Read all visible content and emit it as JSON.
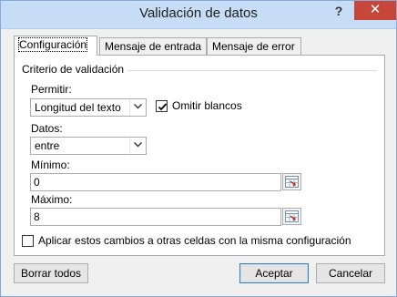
{
  "window": {
    "title": "Validación de datos",
    "help_label": "?",
    "close_label": "✕"
  },
  "tabs": [
    {
      "label": "Configuración",
      "active": true
    },
    {
      "label": "Mensaje de entrada",
      "active": false
    },
    {
      "label": "Mensaje de error",
      "active": false
    }
  ],
  "criteria": {
    "group_title": "Criterio de validación",
    "permitir": {
      "label": "Permitir:",
      "value": "Longitud del texto"
    },
    "omitir_blancos": {
      "label": "Omitir blancos",
      "checked": true
    },
    "datos": {
      "label": "Datos:",
      "value": "entre"
    },
    "minimo": {
      "label": "Mínimo:",
      "value": "0"
    },
    "maximo": {
      "label": "Máximo:",
      "value": "8"
    }
  },
  "apply_all": {
    "label": "Aplicar estos cambios a otras celdas con la misma configuración",
    "checked": false
  },
  "buttons": {
    "clear_all": "Borrar todos",
    "accept": "Aceptar",
    "cancel": "Cancelar"
  },
  "icons": {
    "help": "help-icon",
    "close": "close-icon",
    "dropdown": "chevron-down-icon",
    "checkmark": "checkmark-icon",
    "range_selector": "range-selector-icon"
  },
  "colors": {
    "titlebar": "#c7dcf5",
    "close_button": "#c7463a",
    "default_button_border": "#3c7fb1"
  }
}
